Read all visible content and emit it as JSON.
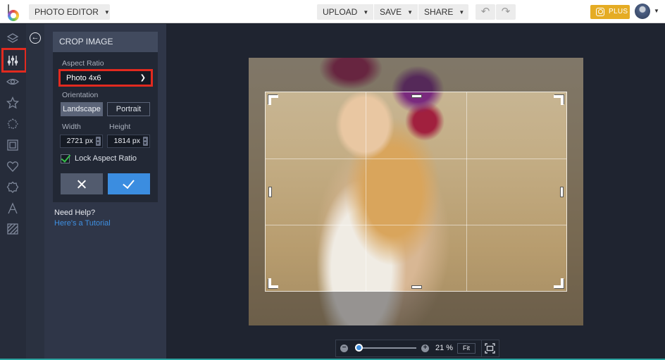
{
  "topbar": {
    "logo": "befunky-logo",
    "app_menu": "PHOTO EDITOR",
    "upload": "UPLOAD",
    "save": "SAVE",
    "share": "SHARE",
    "undo_icon": "↶",
    "redo_icon": "↷",
    "plus": "PLUS",
    "caret": "▼"
  },
  "rail": {
    "items": [
      {
        "name": "layers",
        "active": false
      },
      {
        "name": "edit-adjust",
        "active": true
      },
      {
        "name": "effects",
        "active": false
      },
      {
        "name": "artsy",
        "active": false
      },
      {
        "name": "touch-up",
        "active": false
      },
      {
        "name": "frames",
        "active": false
      },
      {
        "name": "graphics",
        "active": false
      },
      {
        "name": "overlays",
        "active": false
      },
      {
        "name": "text",
        "active": false
      },
      {
        "name": "textures",
        "active": false
      }
    ]
  },
  "back_icon": "←",
  "crop": {
    "title": "CROP IMAGE",
    "aspect_label": "Aspect Ratio",
    "aspect_value": "Photo 4x6",
    "orientation_label": "Orientation",
    "landscape": "Landscape",
    "portrait": "Portrait",
    "orientation_selected": "Landscape",
    "width_label": "Width",
    "height_label": "Height",
    "width_value": "2721 px",
    "height_value": "1814 px",
    "lock_label": "Lock Aspect Ratio",
    "lock_checked": true
  },
  "help": {
    "title": "Need Help?",
    "link": "Here's a Tutorial"
  },
  "zoom": {
    "minus": "−",
    "plus": "+",
    "percent": "21 %",
    "level": 0.05,
    "fit": "Fit"
  },
  "colors": {
    "accent": "#3b8de0",
    "highlight_red": "#e12a1f",
    "plus_gold": "#e5ac24",
    "check_green": "#36c24a"
  }
}
